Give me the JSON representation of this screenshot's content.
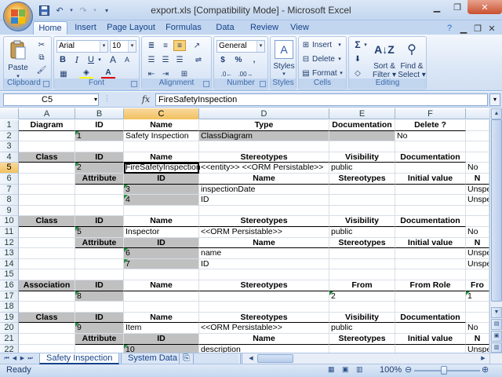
{
  "window": {
    "title": "export.xls  [Compatibility Mode] - Microsoft Excel"
  },
  "ribbon_tabs": [
    "Home",
    "Insert",
    "Page Layout",
    "Formulas",
    "Data",
    "Review",
    "View"
  ],
  "ribbon": {
    "clipboard": {
      "label": "Clipboard",
      "paste": "Paste"
    },
    "font": {
      "label": "Font",
      "name": "Arial",
      "size": "10",
      "bold": "B",
      "italic": "I",
      "underline": "U",
      "grow": "A",
      "shrink": "A"
    },
    "alignment": {
      "label": "Alignment"
    },
    "number": {
      "label": "Number",
      "format": "General",
      "currency": "$",
      "percent": "%",
      "comma": ","
    },
    "styles": {
      "label": "Styles",
      "styles_btn": "Styles"
    },
    "cells": {
      "label": "Cells",
      "insert": "Insert",
      "delete": "Delete",
      "format": "Format"
    },
    "editing": {
      "label": "Editing",
      "sort_filter_1": "Sort &",
      "sort_filter_2": "Filter",
      "find_select_1": "Find &",
      "find_select_2": "Select",
      "sigma": "Σ"
    }
  },
  "formula_bar": {
    "name_box": "C5",
    "fx": "fx",
    "value": "FireSafetyInspection"
  },
  "columns": [
    "A",
    "B",
    "C",
    "D",
    "E",
    "F"
  ],
  "rows": [
    {
      "n": "1",
      "cells": [
        {
          "t": "Diagram",
          "s": "b"
        },
        {
          "t": "ID",
          "s": "b"
        },
        {
          "t": "Name",
          "s": "b"
        },
        {
          "t": "Type",
          "s": "b"
        },
        {
          "t": "Documentation",
          "s": "b"
        },
        {
          "t": "Delete ?",
          "s": "b"
        },
        {
          "t": "",
          "s": ""
        }
      ]
    },
    {
      "n": "2",
      "cells": [
        {
          "t": "",
          "s": ""
        },
        {
          "t": "1",
          "s": "gray tri"
        },
        {
          "t": "Safety Inspection",
          "s": ""
        },
        {
          "t": "ClassDiagram",
          "s": "gray"
        },
        {
          "t": "",
          "s": "gray"
        },
        {
          "t": "No",
          "s": ""
        },
        {
          "t": "",
          "s": ""
        }
      ]
    },
    {
      "n": "3",
      "cells": [
        {
          "t": "",
          "s": ""
        },
        {
          "t": "",
          "s": ""
        },
        {
          "t": "",
          "s": ""
        },
        {
          "t": "",
          "s": ""
        },
        {
          "t": "",
          "s": ""
        },
        {
          "t": "",
          "s": ""
        },
        {
          "t": "",
          "s": ""
        }
      ]
    },
    {
      "n": "4",
      "cells": [
        {
          "t": "Class",
          "s": "b gray"
        },
        {
          "t": "ID",
          "s": "b gray"
        },
        {
          "t": "Name",
          "s": "b"
        },
        {
          "t": "Stereotypes",
          "s": "b"
        },
        {
          "t": "Visibility",
          "s": "b"
        },
        {
          "t": "Documentation",
          "s": "b"
        },
        {
          "t": "",
          "s": ""
        }
      ]
    },
    {
      "n": "5",
      "cells": [
        {
          "t": "",
          "s": ""
        },
        {
          "t": "2",
          "s": "gray tri"
        },
        {
          "t": "FireSafetyInspection",
          "s": "active"
        },
        {
          "t": "<<entity>> <<ORM Persistable>>",
          "s": ""
        },
        {
          "t": "public",
          "s": ""
        },
        {
          "t": "",
          "s": ""
        },
        {
          "t": "No",
          "s": ""
        }
      ]
    },
    {
      "n": "6",
      "cells": [
        {
          "t": "",
          "s": ""
        },
        {
          "t": "Attribute",
          "s": "b gray"
        },
        {
          "t": "ID",
          "s": "b gray"
        },
        {
          "t": "Name",
          "s": "b"
        },
        {
          "t": "Stereotypes",
          "s": "b"
        },
        {
          "t": "Initial value",
          "s": "b"
        },
        {
          "t": "N",
          "s": "b"
        }
      ]
    },
    {
      "n": "7",
      "cells": [
        {
          "t": "",
          "s": ""
        },
        {
          "t": "",
          "s": ""
        },
        {
          "t": "3",
          "s": "gray tri"
        },
        {
          "t": "inspectionDate",
          "s": ""
        },
        {
          "t": "",
          "s": ""
        },
        {
          "t": "",
          "s": ""
        },
        {
          "t": "Unspe",
          "s": ""
        }
      ]
    },
    {
      "n": "8",
      "cells": [
        {
          "t": "",
          "s": ""
        },
        {
          "t": "",
          "s": ""
        },
        {
          "t": "4",
          "s": "gray tri"
        },
        {
          "t": "ID",
          "s": ""
        },
        {
          "t": "",
          "s": ""
        },
        {
          "t": "",
          "s": ""
        },
        {
          "t": "Unspe",
          "s": ""
        }
      ]
    },
    {
      "n": "9",
      "cells": [
        {
          "t": "",
          "s": ""
        },
        {
          "t": "",
          "s": ""
        },
        {
          "t": "",
          "s": ""
        },
        {
          "t": "",
          "s": ""
        },
        {
          "t": "",
          "s": ""
        },
        {
          "t": "",
          "s": ""
        },
        {
          "t": "",
          "s": ""
        }
      ]
    },
    {
      "n": "10",
      "cells": [
        {
          "t": "Class",
          "s": "b gray"
        },
        {
          "t": "ID",
          "s": "b gray"
        },
        {
          "t": "Name",
          "s": "b"
        },
        {
          "t": "Stereotypes",
          "s": "b"
        },
        {
          "t": "Visibility",
          "s": "b"
        },
        {
          "t": "Documentation",
          "s": "b"
        },
        {
          "t": "",
          "s": ""
        }
      ]
    },
    {
      "n": "11",
      "cells": [
        {
          "t": "",
          "s": ""
        },
        {
          "t": "5",
          "s": "gray tri"
        },
        {
          "t": "Inspector",
          "s": ""
        },
        {
          "t": "<<ORM Persistable>>",
          "s": ""
        },
        {
          "t": "public",
          "s": ""
        },
        {
          "t": "",
          "s": ""
        },
        {
          "t": "No",
          "s": ""
        }
      ]
    },
    {
      "n": "12",
      "cells": [
        {
          "t": "",
          "s": ""
        },
        {
          "t": "Attribute",
          "s": "b gray"
        },
        {
          "t": "ID",
          "s": "b gray"
        },
        {
          "t": "Name",
          "s": "b"
        },
        {
          "t": "Stereotypes",
          "s": "b"
        },
        {
          "t": "Initial value",
          "s": "b"
        },
        {
          "t": "N",
          "s": "b"
        }
      ]
    },
    {
      "n": "13",
      "cells": [
        {
          "t": "",
          "s": ""
        },
        {
          "t": "",
          "s": ""
        },
        {
          "t": "6",
          "s": "gray tri"
        },
        {
          "t": "name",
          "s": ""
        },
        {
          "t": "",
          "s": ""
        },
        {
          "t": "",
          "s": ""
        },
        {
          "t": "Unspe",
          "s": ""
        }
      ]
    },
    {
      "n": "14",
      "cells": [
        {
          "t": "",
          "s": ""
        },
        {
          "t": "",
          "s": ""
        },
        {
          "t": "7",
          "s": "gray tri"
        },
        {
          "t": "ID",
          "s": ""
        },
        {
          "t": "",
          "s": ""
        },
        {
          "t": "",
          "s": ""
        },
        {
          "t": "Unspe",
          "s": ""
        }
      ]
    },
    {
      "n": "15",
      "cells": [
        {
          "t": "",
          "s": ""
        },
        {
          "t": "",
          "s": ""
        },
        {
          "t": "",
          "s": ""
        },
        {
          "t": "",
          "s": ""
        },
        {
          "t": "",
          "s": ""
        },
        {
          "t": "",
          "s": ""
        },
        {
          "t": "",
          "s": ""
        }
      ]
    },
    {
      "n": "16",
      "cells": [
        {
          "t": "Association",
          "s": "b gray"
        },
        {
          "t": "ID",
          "s": "b gray"
        },
        {
          "t": "Name",
          "s": "b"
        },
        {
          "t": "Stereotypes",
          "s": "b"
        },
        {
          "t": "From",
          "s": "b"
        },
        {
          "t": "From Role",
          "s": "b"
        },
        {
          "t": "Fro",
          "s": "b"
        }
      ]
    },
    {
      "n": "17",
      "cells": [
        {
          "t": "",
          "s": ""
        },
        {
          "t": "8",
          "s": "gray tri"
        },
        {
          "t": "",
          "s": ""
        },
        {
          "t": "",
          "s": ""
        },
        {
          "t": "2",
          "s": "tri"
        },
        {
          "t": "",
          "s": ""
        },
        {
          "t": "1",
          "s": "tri"
        }
      ]
    },
    {
      "n": "18",
      "cells": [
        {
          "t": "",
          "s": ""
        },
        {
          "t": "",
          "s": ""
        },
        {
          "t": "",
          "s": ""
        },
        {
          "t": "",
          "s": ""
        },
        {
          "t": "",
          "s": ""
        },
        {
          "t": "",
          "s": ""
        },
        {
          "t": "",
          "s": ""
        }
      ]
    },
    {
      "n": "19",
      "cells": [
        {
          "t": "Class",
          "s": "b gray"
        },
        {
          "t": "ID",
          "s": "b gray"
        },
        {
          "t": "Name",
          "s": "b"
        },
        {
          "t": "Stereotypes",
          "s": "b"
        },
        {
          "t": "Visibility",
          "s": "b"
        },
        {
          "t": "Documentation",
          "s": "b"
        },
        {
          "t": "",
          "s": ""
        }
      ]
    },
    {
      "n": "20",
      "cells": [
        {
          "t": "",
          "s": ""
        },
        {
          "t": "9",
          "s": "gray tri"
        },
        {
          "t": "Item",
          "s": ""
        },
        {
          "t": "<<ORM Persistable>>",
          "s": ""
        },
        {
          "t": "public",
          "s": ""
        },
        {
          "t": "",
          "s": ""
        },
        {
          "t": "No",
          "s": ""
        }
      ]
    },
    {
      "n": "21",
      "cells": [
        {
          "t": "",
          "s": ""
        },
        {
          "t": "Attribute",
          "s": "b gray"
        },
        {
          "t": "ID",
          "s": "b gray"
        },
        {
          "t": "Name",
          "s": "b"
        },
        {
          "t": "Stereotypes",
          "s": "b"
        },
        {
          "t": "Initial value",
          "s": "b"
        },
        {
          "t": "N",
          "s": "b"
        }
      ]
    },
    {
      "n": "22",
      "cells": [
        {
          "t": "",
          "s": ""
        },
        {
          "t": "",
          "s": ""
        },
        {
          "t": "10",
          "s": "gray tri"
        },
        {
          "t": "description",
          "s": ""
        },
        {
          "t": "",
          "s": ""
        },
        {
          "t": "",
          "s": ""
        },
        {
          "t": "Unspe",
          "s": ""
        }
      ]
    }
  ],
  "sheet_tabs": [
    "Safety Inspection",
    "System Data"
  ],
  "status": {
    "text": "Ready",
    "zoom": "100%"
  }
}
